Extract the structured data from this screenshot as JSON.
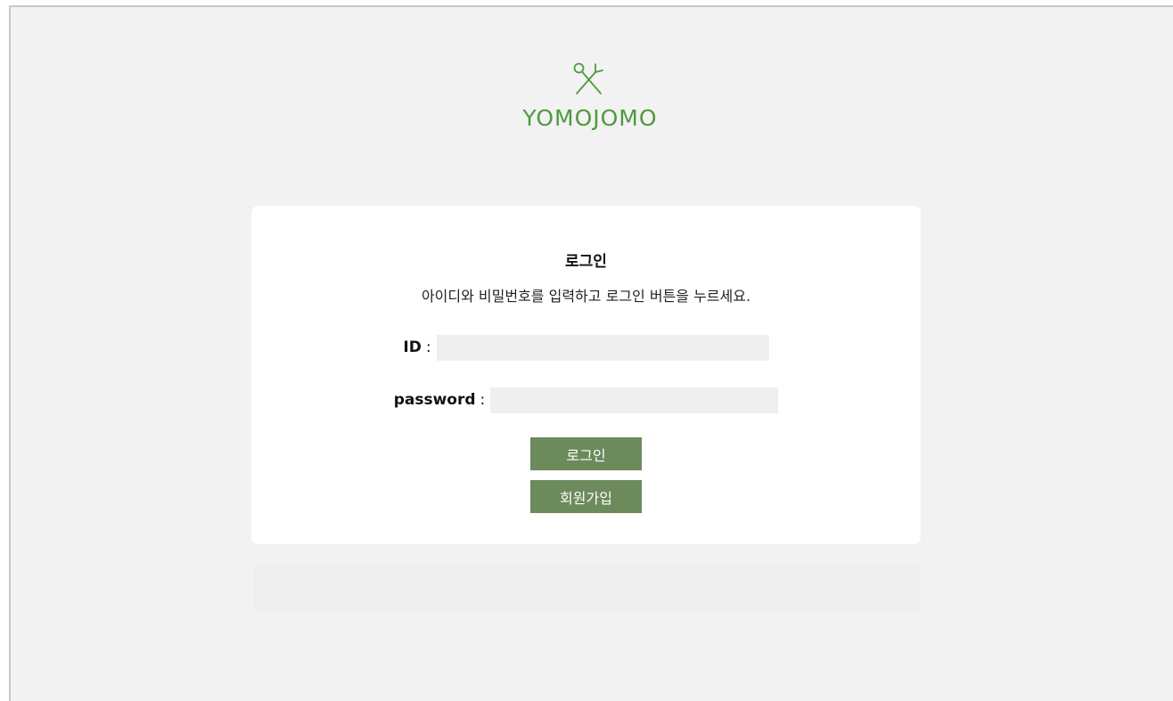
{
  "brand": {
    "name": "YOMOJOMO",
    "color": "#4e9a3e"
  },
  "login": {
    "title": "로그인",
    "description": "아이디와 비밀번호를 입력하고 로그인 버튼을 누르세요.",
    "id_label": "ID",
    "id_value": "",
    "password_label": "password",
    "password_value": "",
    "colon": ":",
    "login_button": "로그인",
    "signup_button": "회원가입"
  },
  "theme": {
    "button_color": "#6c8a5c",
    "background": "#f2f2f2",
    "input_background": "#efefef"
  }
}
